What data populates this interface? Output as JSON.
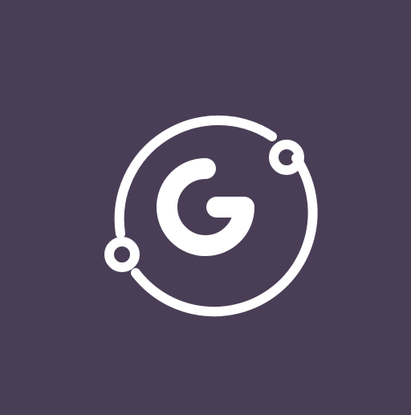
{
  "logo": {
    "icon": "g-orbit-logo-icon",
    "letter": "G",
    "letter_rendered_as_picture": true
  },
  "colors": {
    "background": "#4a3e56",
    "foreground": "#ffffff"
  }
}
